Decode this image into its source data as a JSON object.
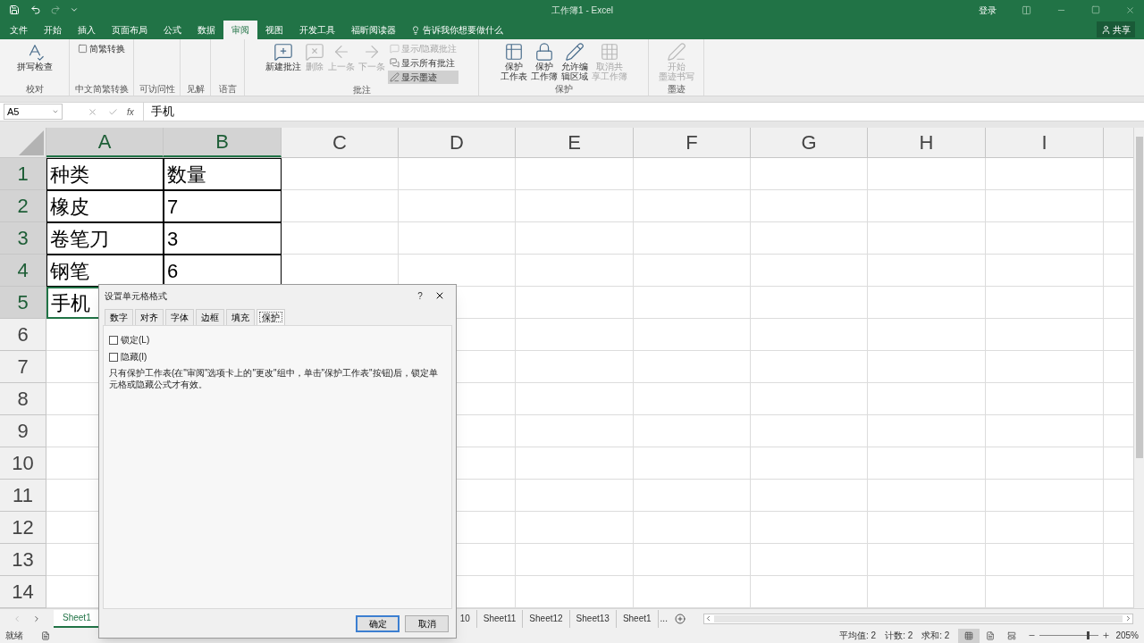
{
  "window": {
    "title": "工作簿1 - Excel",
    "sign_in": "登录",
    "share": "共享"
  },
  "menu_tabs": [
    {
      "label": "文件",
      "selected": false
    },
    {
      "label": "开始",
      "selected": false
    },
    {
      "label": "插入",
      "selected": false
    },
    {
      "label": "页面布局",
      "selected": false
    },
    {
      "label": "公式",
      "selected": false
    },
    {
      "label": "数据",
      "selected": false
    },
    {
      "label": "审阅",
      "selected": true
    },
    {
      "label": "视图",
      "selected": false
    },
    {
      "label": "开发工具",
      "selected": false
    },
    {
      "label": "福昕阅读器",
      "selected": false
    }
  ],
  "tell_me": "告诉我你想要做什么",
  "ribbon": {
    "groups": [
      {
        "label": "校对",
        "items": [
          {
            "kind": "large",
            "lines": [
              "拼写检查"
            ],
            "disabled": false
          }
        ]
      },
      {
        "label": "中文简繁转换",
        "items": [
          {
            "kind": "small",
            "text": "简繁转换",
            "disabled": false,
            "on": false
          }
        ]
      },
      {
        "label": "可访问性"
      },
      {
        "label": "见解"
      },
      {
        "label": "语言"
      },
      {
        "label": "批注",
        "items": [
          {
            "kind": "large",
            "lines": [
              "新建批注"
            ],
            "disabled": false
          },
          {
            "kind": "large",
            "lines": [
              "删除"
            ],
            "disabled": true
          },
          {
            "kind": "large",
            "lines": [
              "上一条"
            ],
            "disabled": true
          },
          {
            "kind": "large",
            "lines": [
              "下一条"
            ],
            "disabled": true
          },
          {
            "kind": "small",
            "text": "显示/隐藏批注",
            "disabled": true,
            "on": false
          },
          {
            "kind": "small",
            "text": "显示所有批注",
            "disabled": false,
            "on": false
          },
          {
            "kind": "small",
            "text": "显示墨迹",
            "disabled": false,
            "on": true
          }
        ]
      },
      {
        "label": "保护",
        "items": [
          {
            "kind": "large",
            "lines": [
              "保护",
              "工作表"
            ],
            "disabled": false
          },
          {
            "kind": "large",
            "lines": [
              "保护",
              "工作簿"
            ],
            "disabled": false
          },
          {
            "kind": "large",
            "lines": [
              "允许编",
              "辑区域"
            ],
            "disabled": false
          },
          {
            "kind": "large",
            "lines": [
              "取消共",
              "享工作簿"
            ],
            "disabled": true
          }
        ]
      },
      {
        "label": "墨迹",
        "items": [
          {
            "kind": "large",
            "lines": [
              "开始",
              "墨迹书写"
            ],
            "disabled": true
          }
        ]
      }
    ]
  },
  "formula_bar": {
    "name_box": "A5",
    "function_label": "fx",
    "value": "手机"
  },
  "sheet": {
    "columns": [
      {
        "label": "A",
        "selected": true
      },
      {
        "label": "B",
        "selected": true
      },
      {
        "label": "C",
        "selected": false
      },
      {
        "label": "D",
        "selected": false
      },
      {
        "label": "E",
        "selected": false
      },
      {
        "label": "F",
        "selected": false
      },
      {
        "label": "G",
        "selected": false
      },
      {
        "label": "H",
        "selected": false
      },
      {
        "label": "I",
        "selected": false
      }
    ],
    "rows": [
      {
        "label": "1",
        "selected": true,
        "cells": [
          {
            "text": "种类",
            "active": false
          },
          {
            "text": "数量",
            "active": false
          }
        ]
      },
      {
        "label": "2",
        "selected": true,
        "cells": [
          {
            "text": "橡皮",
            "active": false
          },
          {
            "text": "7",
            "active": false
          }
        ]
      },
      {
        "label": "3",
        "selected": true,
        "cells": [
          {
            "text": "卷笔刀",
            "active": false
          },
          {
            "text": "3",
            "active": false
          }
        ]
      },
      {
        "label": "4",
        "selected": true,
        "cells": [
          {
            "text": "钢笔",
            "active": false
          },
          {
            "text": "6",
            "active": false
          }
        ]
      },
      {
        "label": "5",
        "selected": true,
        "cells": [
          {
            "text": "手机",
            "active": true
          }
        ]
      },
      {
        "label": "6",
        "selected": false
      },
      {
        "label": "7",
        "selected": false
      },
      {
        "label": "8",
        "selected": false
      },
      {
        "label": "9",
        "selected": false
      },
      {
        "label": "10",
        "selected": false
      },
      {
        "label": "11",
        "selected": false
      },
      {
        "label": "12",
        "selected": false
      },
      {
        "label": "13",
        "selected": false
      },
      {
        "label": "14",
        "selected": false
      }
    ]
  },
  "sheet_tabs": {
    "first": {
      "label": "Sheet1",
      "selected": true
    },
    "rest": [
      {
        "label": "10",
        "selected": false
      },
      {
        "label": "Sheet11",
        "selected": false
      },
      {
        "label": "Sheet12",
        "selected": false
      },
      {
        "label": "Sheet13",
        "selected": false
      },
      {
        "label": "Sheet1",
        "selected": false
      }
    ],
    "more": "..."
  },
  "status_bar": {
    "ready": "就绪",
    "stats": [
      "平均值: 2",
      "计数: 2",
      "求和: 2"
    ],
    "views": [
      {
        "selected": true
      },
      {
        "selected": false
      },
      {
        "selected": false
      }
    ],
    "zoom": {
      "level": 0.8,
      "reading": "205%"
    }
  },
  "dialog": {
    "title": "设置单元格格式",
    "help": "?",
    "tabs": [
      {
        "label": "数字",
        "selected": false
      },
      {
        "label": "对齐",
        "selected": false
      },
      {
        "label": "字体",
        "selected": false
      },
      {
        "label": "边框",
        "selected": false
      },
      {
        "label": "填充",
        "selected": false
      },
      {
        "label": "保护",
        "selected": true
      }
    ],
    "checkboxes": [
      {
        "label": "锁定(L)",
        "checked": false
      },
      {
        "label": "隐藏(I)",
        "checked": false
      }
    ],
    "note": "只有保护工作表(在\"审阅\"选项卡上的\"更改\"组中，单击\"保护工作表\"按钮)后，锁定单元格或隐藏公式才有效。",
    "buttons": [
      {
        "label": "确定",
        "default": true
      },
      {
        "label": "取消",
        "default": false
      }
    ]
  }
}
